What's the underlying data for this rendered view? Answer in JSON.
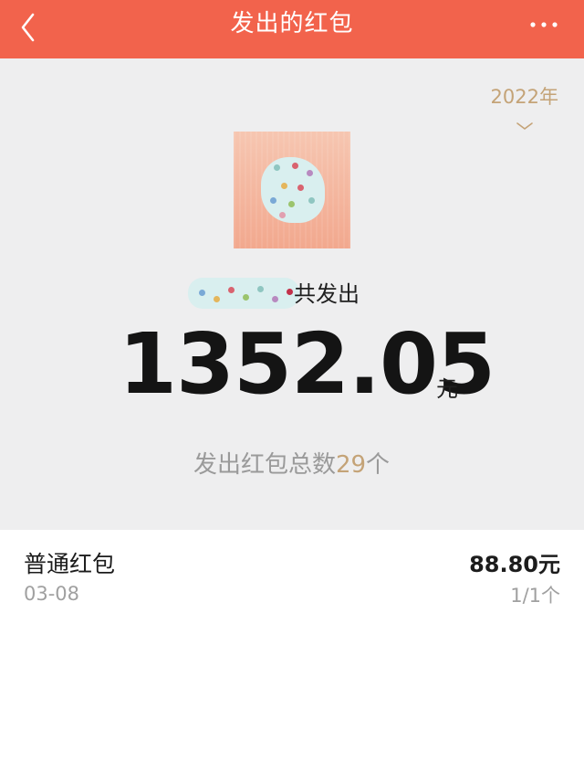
{
  "header": {
    "title": "发出的红包",
    "back_icon": "chevron-left-icon",
    "more_icon": "more-horizontal-icon",
    "bar_color": "#f2634c"
  },
  "summary": {
    "year": "2022年",
    "year_icon": "chevron-down-icon",
    "sender_suffix": "共发出",
    "amount": "1352.05",
    "amount_unit": "元",
    "count_prefix": "发出红包总数",
    "count_value": "29",
    "count_suffix": "个",
    "accent_color": "#c4a377"
  },
  "list": {
    "items": [
      {
        "title": "普通红包",
        "date": "03-08",
        "amount": "88.80元",
        "count": "1/1个"
      }
    ]
  }
}
